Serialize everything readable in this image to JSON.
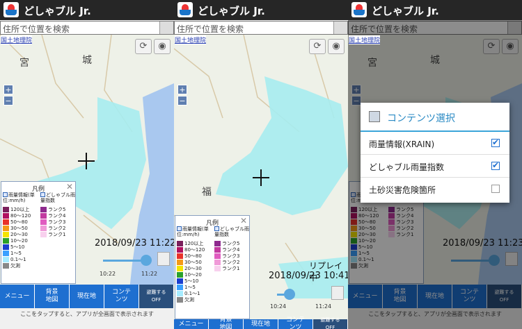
{
  "app": {
    "title": "どしゃブル Jr."
  },
  "search": {
    "placeholder": "住所で位置を検索"
  },
  "map": {
    "attribution": "国土地理院",
    "labels": {
      "miya": "宮",
      "shiro": "城",
      "fuku": "福"
    }
  },
  "zoom": {
    "in": "+",
    "out": "−"
  },
  "legend": {
    "title": "凡例",
    "rain_header": "雨量情報(単位:mm/h)",
    "dosha_header": "どしゃブル雨量指数",
    "rain": [
      {
        "label": "120以上",
        "color": "#7a1f5c"
      },
      {
        "label": "80〜120",
        "color": "#b01060"
      },
      {
        "label": "50〜80",
        "color": "#e8322a"
      },
      {
        "label": "30〜50",
        "color": "#f59a18"
      },
      {
        "label": "20〜30",
        "color": "#f4e400"
      },
      {
        "label": "10〜20",
        "color": "#2ba02b"
      },
      {
        "label": "5〜10",
        "color": "#1a3fd0"
      },
      {
        "label": "1〜5",
        "color": "#3aa0ff"
      },
      {
        "label": "0.1〜1",
        "color": "#a6ecff"
      },
      {
        "label": "欠測",
        "color": "#888888"
      }
    ],
    "ranks": [
      {
        "label": "ランク5",
        "color": "#8e2a8e"
      },
      {
        "label": "ランク4",
        "color": "#c23aa0"
      },
      {
        "label": "ランク3",
        "color": "#e05cc0"
      },
      {
        "label": "ランク2",
        "color": "#f09ad8"
      },
      {
        "label": "ランク1",
        "color": "#f8d0ee"
      }
    ]
  },
  "time": {
    "panel1": "2018/09/23 11:22",
    "panel2": "2018/09/23 10:41",
    "panel3": "2018/09/23 11:23"
  },
  "ticks": {
    "p1_left": "10:22",
    "p1_right": "11:22",
    "p2_left": "10:24",
    "p2_right": "11:24"
  },
  "replay": "リプレイ中",
  "bottom": {
    "menu": "メニュー",
    "background": "背景\n地図",
    "current": "現在地",
    "contents": "コンテ\nンツ",
    "evac": "避難する\nOFF"
  },
  "footer": "ここをタップすると、アプリが全画面で表示されます",
  "dialog": {
    "title": "コンテンツ選択",
    "items": [
      {
        "label": "雨量情報(XRAIN)",
        "checked": true
      },
      {
        "label": "どしゃブル雨量指数",
        "checked": true
      },
      {
        "label": "土砂災害危険箇所",
        "checked": false
      }
    ]
  },
  "colors": {
    "accent": "#1e6fd0",
    "rain_area": "#a6ecf0",
    "sea": "#a9c8ef"
  }
}
